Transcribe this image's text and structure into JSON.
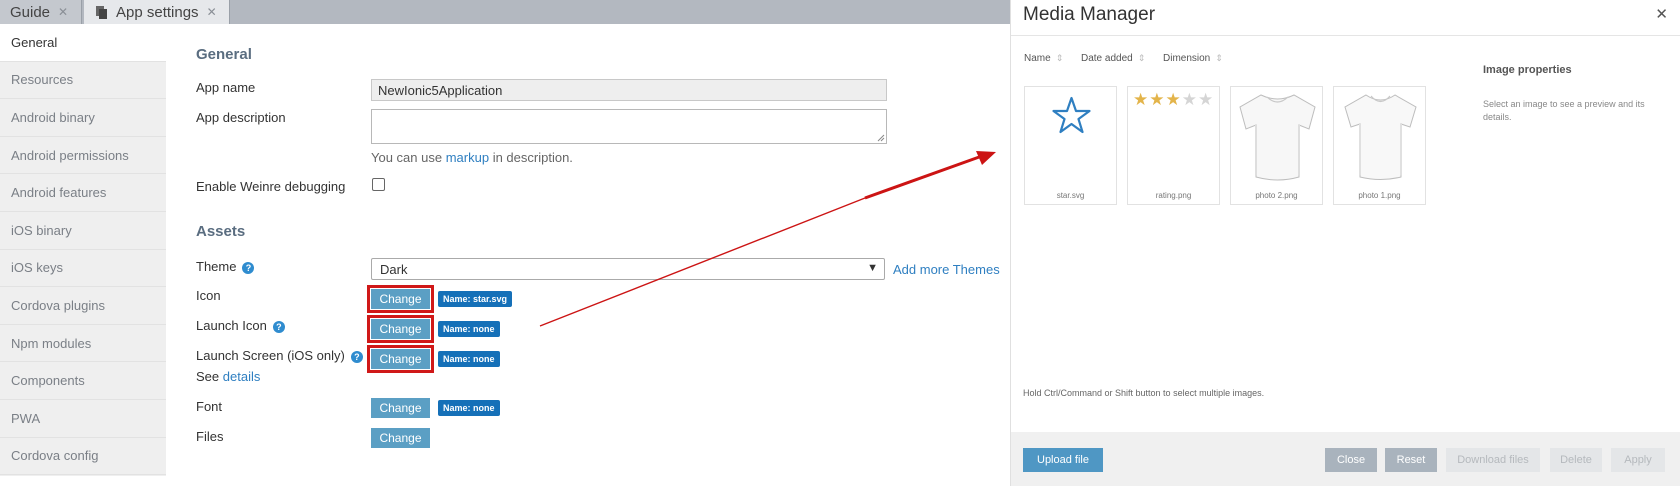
{
  "tabs": [
    {
      "label": "Guide"
    },
    {
      "label": "App settings"
    }
  ],
  "sidebar": {
    "items": [
      {
        "label": "General"
      },
      {
        "label": "Resources"
      },
      {
        "label": "Android binary"
      },
      {
        "label": "Android permissions"
      },
      {
        "label": "Android features"
      },
      {
        "label": "iOS binary"
      },
      {
        "label": "iOS keys"
      },
      {
        "label": "Cordova plugins"
      },
      {
        "label": "Npm modules"
      },
      {
        "label": "Components"
      },
      {
        "label": "PWA"
      },
      {
        "label": "Cordova config"
      }
    ]
  },
  "general": {
    "title": "General",
    "app_name_label": "App name",
    "app_name_value": "NewIonic5Application",
    "app_description_label": "App description",
    "hint_prefix": "You can use",
    "hint_link": "markup",
    "hint_suffix": "in description.",
    "weinre_label": "Enable Weinre debugging"
  },
  "assets": {
    "title": "Assets",
    "theme_label": "Theme",
    "theme_value": "Dark",
    "add_more_themes": "Add more Themes",
    "icon_label": "Icon",
    "launch_icon_label": "Launch Icon",
    "launch_screen_label": "Launch Screen (iOS only)",
    "see_prefix": "See",
    "see_link": "details",
    "font_label": "Font",
    "files_label": "Files",
    "change_label": "Change",
    "icon_badge": "Name: star.svg",
    "launch_icon_badge": "Name: none",
    "launch_screen_badge": "Name: none",
    "font_badge": "Name: none"
  },
  "media_manager": {
    "title": "Media Manager",
    "columns": [
      {
        "label": "Name"
      },
      {
        "label": "Date added"
      },
      {
        "label": "Dimension"
      }
    ],
    "images": [
      {
        "name": "star.svg"
      },
      {
        "name": "rating.png",
        "rating": 3,
        "rating_max": 5
      },
      {
        "name": "photo 2.png"
      },
      {
        "name": "photo 1.png"
      }
    ],
    "properties_title": "Image properties",
    "properties_hint": "Select an image to see a preview and its details.",
    "multi_select_hint": "Hold Ctrl/Command or Shift button to select multiple images.",
    "buttons": {
      "upload": "Upload file",
      "close": "Close",
      "reset": "Reset",
      "download": "Download files",
      "delete": "Delete",
      "apply": "Apply"
    }
  },
  "colors": {
    "accent": "#1570b8",
    "button": "#5b9fc4",
    "highlight": "#d01818"
  }
}
